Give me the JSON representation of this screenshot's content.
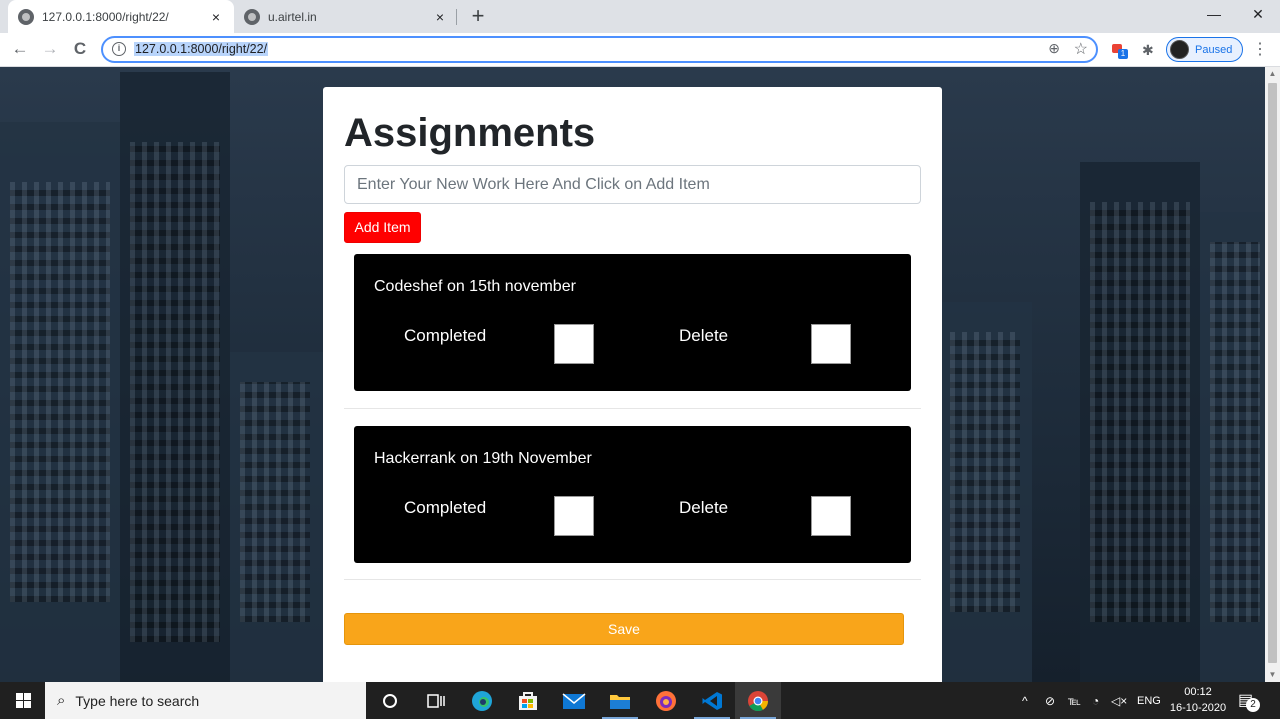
{
  "browser": {
    "tabs": [
      {
        "title": "127.0.0.1:8000/right/22/",
        "close": "×",
        "active": true
      },
      {
        "title": "u.airtel.in",
        "close": "×",
        "active": false
      }
    ],
    "new_tab": "+",
    "window_controls": {
      "minimize": "—",
      "maximize": "❐",
      "close": "✕"
    },
    "nav": {
      "back": "←",
      "forward": "→",
      "reload": "C"
    },
    "address": "127.0.0.1:8000/right/22/",
    "info_icon": "i",
    "zoom_icon": "⊕",
    "star_icon": "☆",
    "extension_badge": "1",
    "puzzle_icon": "✱",
    "profile_status": "Paused",
    "menu_icon": "⋮"
  },
  "page": {
    "title": "Assignments",
    "input_placeholder": "Enter Your New Work Here And Click on Add Item",
    "add_button": "Add Item",
    "items": [
      {
        "title": "Codeshef on 15th november",
        "completed_label": "Completed",
        "delete_label": "Delete"
      },
      {
        "title": "Hackerrank on 19th November",
        "completed_label": "Completed",
        "delete_label": "Delete"
      }
    ],
    "save_button": "Save"
  },
  "scrollbar": {
    "up": "▲",
    "down": "▼"
  },
  "taskbar": {
    "search_placeholder": "Type here to search",
    "search_icon": "⌕",
    "tray_chevron": "^",
    "tray_items": [
      "⊘",
      "℡",
      "◔",
      "◁×"
    ],
    "language": "ENG",
    "time": "00:12",
    "date": "16-10-2020",
    "notification_count": "2",
    "notification_icon": "▤"
  },
  "colors": {
    "add_button": "#ff0000",
    "save_button": "#f9a51a",
    "todo_card": "#000000",
    "accent": "#1a73e8"
  }
}
